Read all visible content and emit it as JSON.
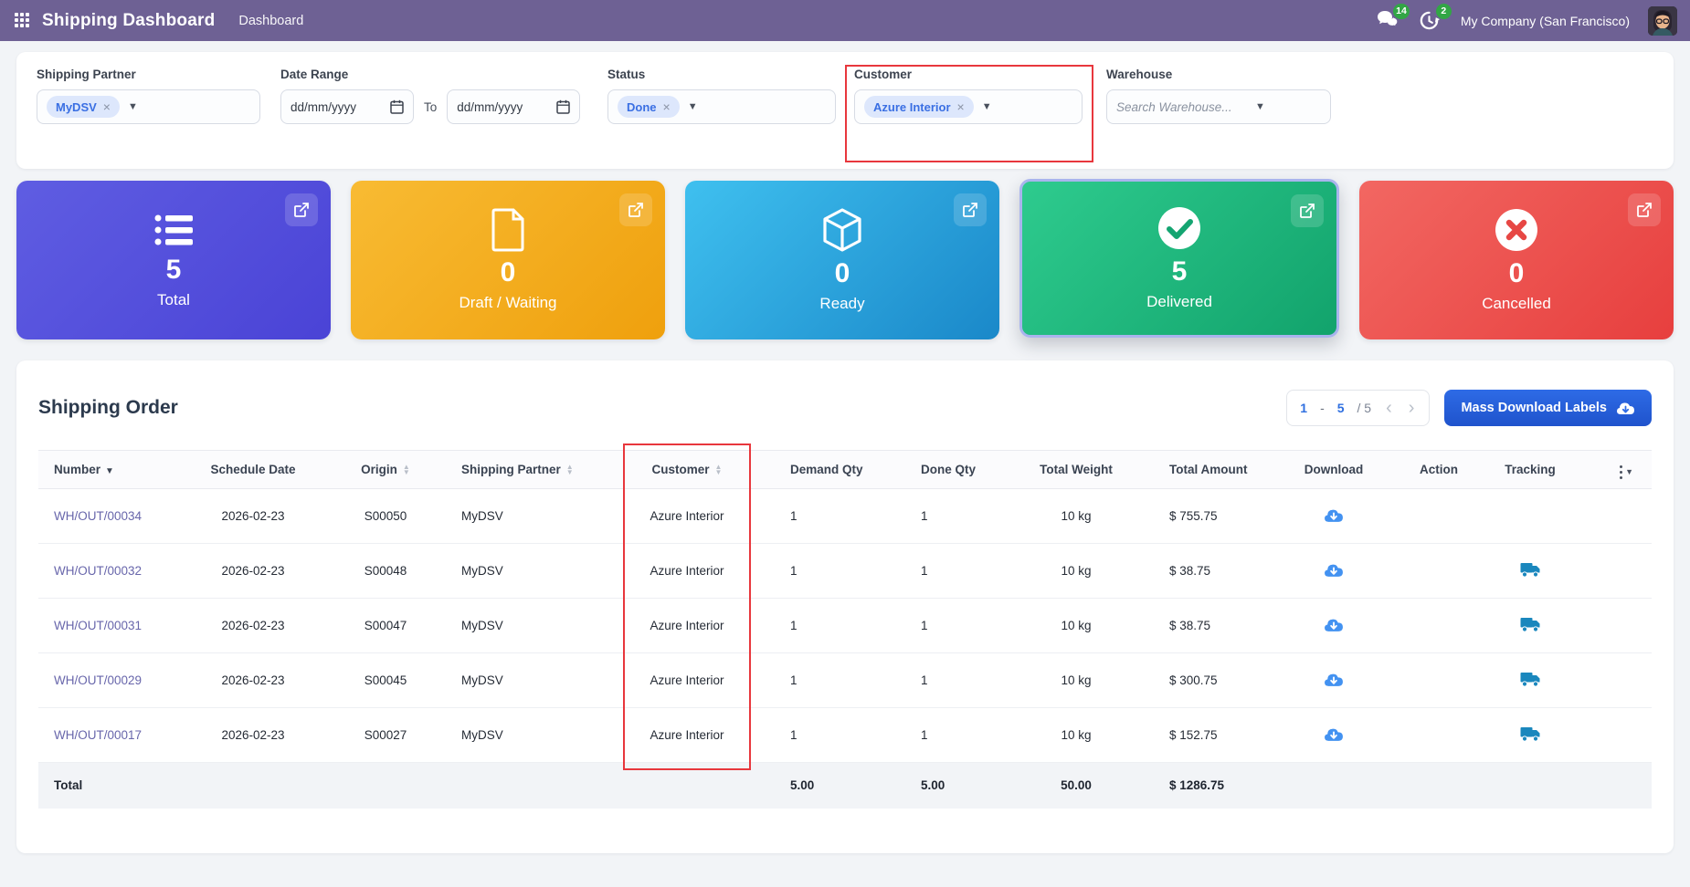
{
  "navbar": {
    "app_title": "Shipping Dashboard",
    "menu_item": "Dashboard",
    "messages_count": "14",
    "activities_count": "2",
    "company": "My Company (San Francisco)",
    "bg_color": "#6e6194",
    "badge_color": "#32a645"
  },
  "filters": {
    "shipping_partner": {
      "label": "Shipping Partner",
      "tag": "MyDSV"
    },
    "date_range": {
      "label": "Date Range",
      "from_placeholder": "dd/mm/yyyy",
      "to_word": "To",
      "to_placeholder": "dd/mm/yyyy"
    },
    "status": {
      "label": "Status",
      "tag": "Done"
    },
    "customer": {
      "label": "Customer",
      "tag": "Azure Interior"
    },
    "warehouse": {
      "label": "Warehouse",
      "placeholder": "Search Warehouse..."
    },
    "highlight_color": "#e8373d"
  },
  "stats": {
    "cards": [
      {
        "value": "5",
        "label": "Total",
        "icon": "list-icon",
        "gradient": "linear-gradient(135deg,#5f5de2,#4a43d6)"
      },
      {
        "value": "0",
        "label": "Draft / Waiting",
        "icon": "document-icon",
        "gradient": "linear-gradient(135deg,#f8bb33,#efa00d)"
      },
      {
        "value": "0",
        "label": "Ready",
        "icon": "cube-icon",
        "gradient": "linear-gradient(135deg,#3fc0ef,#1a88c9)"
      },
      {
        "value": "5",
        "label": "Delivered",
        "icon": "check-circle-icon",
        "gradient": "linear-gradient(135deg,#2ecb8e,#12a36c)",
        "selected": true,
        "selected_border": "#a9b4ed"
      },
      {
        "value": "0",
        "label": "Cancelled",
        "icon": "x-circle-icon",
        "gradient": "linear-gradient(135deg,#f26762,#e73f3e)"
      }
    ]
  },
  "orders": {
    "title": "Shipping Order",
    "pager": {
      "start": "1",
      "dash": "-",
      "end": "5",
      "total": "/ 5",
      "prev": "‹",
      "next": "›"
    },
    "download_button": "Mass Download Labels",
    "button_color": "#2563da",
    "columns": {
      "number": "Number",
      "schedule_date": "Schedule Date",
      "origin": "Origin",
      "shipping_partner": "Shipping Partner",
      "customer": "Customer",
      "demand_qty": "Demand Qty",
      "done_qty": "Done Qty",
      "total_weight": "Total Weight",
      "total_amount": "Total Amount",
      "download": "Download",
      "action": "Action",
      "tracking": "Tracking"
    },
    "rows": [
      {
        "number": "WH/OUT/00034",
        "schedule_date": "2026-02-23",
        "origin": "S00050",
        "shipping_partner": "MyDSV",
        "customer": "Azure Interior",
        "demand_qty": "1",
        "done_qty": "1",
        "total_weight": "10 kg",
        "total_amount": "$ 755.75",
        "has_download": true,
        "has_tracking": false
      },
      {
        "number": "WH/OUT/00032",
        "schedule_date": "2026-02-23",
        "origin": "S00048",
        "shipping_partner": "MyDSV",
        "customer": "Azure Interior",
        "demand_qty": "1",
        "done_qty": "1",
        "total_weight": "10 kg",
        "total_amount": "$ 38.75",
        "has_download": true,
        "has_tracking": true
      },
      {
        "number": "WH/OUT/00031",
        "schedule_date": "2026-02-23",
        "origin": "S00047",
        "shipping_partner": "MyDSV",
        "customer": "Azure Interior",
        "demand_qty": "1",
        "done_qty": "1",
        "total_weight": "10 kg",
        "total_amount": "$ 38.75",
        "has_download": true,
        "has_tracking": true
      },
      {
        "number": "WH/OUT/00029",
        "schedule_date": "2026-02-23",
        "origin": "S00045",
        "shipping_partner": "MyDSV",
        "customer": "Azure Interior",
        "demand_qty": "1",
        "done_qty": "1",
        "total_weight": "10 kg",
        "total_amount": "$ 300.75",
        "has_download": true,
        "has_tracking": true
      },
      {
        "number": "WH/OUT/00017",
        "schedule_date": "2026-02-23",
        "origin": "S00027",
        "shipping_partner": "MyDSV",
        "customer": "Azure Interior",
        "demand_qty": "1",
        "done_qty": "1",
        "total_weight": "10 kg",
        "total_amount": "$ 152.75",
        "has_download": true,
        "has_tracking": true
      }
    ],
    "totals": {
      "label": "Total",
      "demand_qty": "5.00",
      "done_qty": "5.00",
      "total_weight": "50.00",
      "total_amount": "$ 1286.75"
    }
  }
}
